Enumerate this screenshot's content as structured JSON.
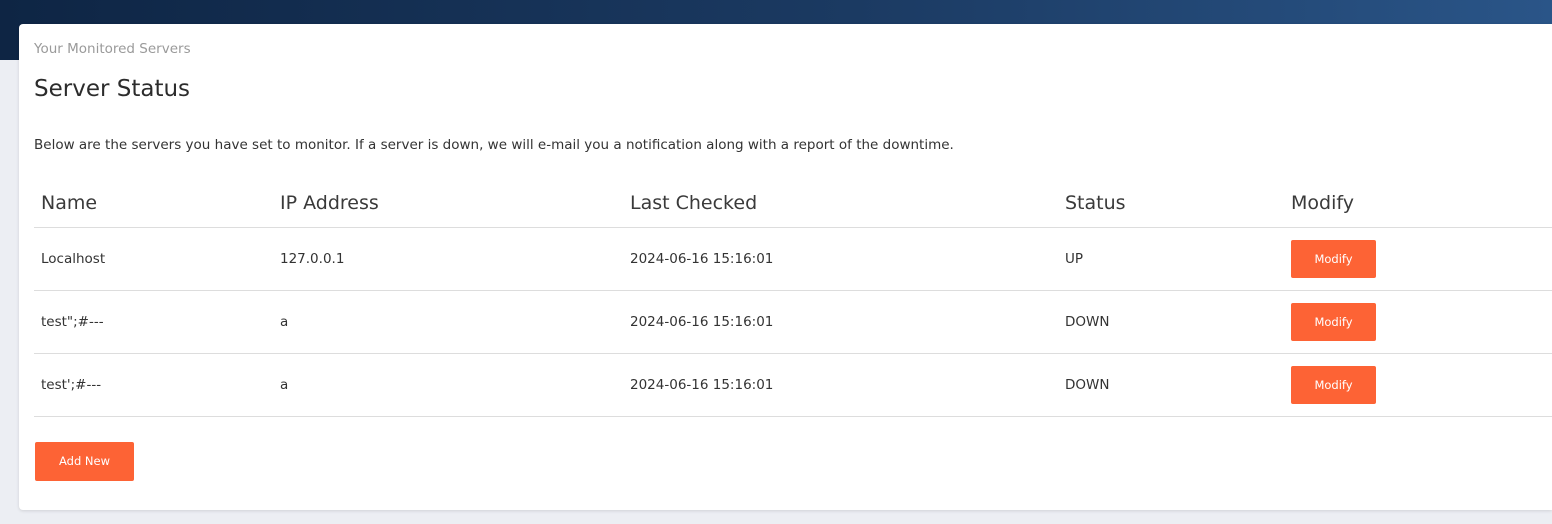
{
  "card": {
    "subtitle": "Your Monitored Servers",
    "title": "Server Status",
    "description": "Below are the servers you have set to monitor. If a server is down, we will e-mail you a notification along with a report of the downtime."
  },
  "table": {
    "headers": [
      "Name",
      "IP Address",
      "Last Checked",
      "Status",
      "Modify"
    ],
    "rows": [
      {
        "name": "Localhost",
        "ip": "127.0.0.1",
        "last_checked": "2024-06-16 15:16:01",
        "status": "UP",
        "modify_label": "Modify"
      },
      {
        "name": "test\";#---",
        "ip": "a",
        "last_checked": "2024-06-16 15:16:01",
        "status": "DOWN",
        "modify_label": "Modify"
      },
      {
        "name": "test';#---",
        "ip": "a",
        "last_checked": "2024-06-16 15:16:01",
        "status": "DOWN",
        "modify_label": "Modify"
      }
    ]
  },
  "actions": {
    "add_new_label": "Add New"
  },
  "colors": {
    "accent": "#fd6335",
    "header_bg_start": "#0e2544",
    "header_bg_end": "#2a5588",
    "page_bg": "#eceef3"
  }
}
